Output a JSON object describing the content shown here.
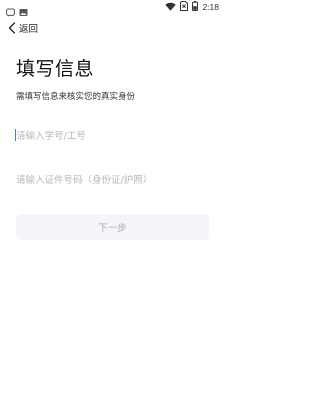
{
  "status_bar": {
    "time": "2:18",
    "icons": [
      "notification-icon",
      "image-icon",
      "wifi-icon",
      "no-sim-icon",
      "battery-icon"
    ]
  },
  "nav": {
    "back_label": "返回",
    "back_icon": "chevron-left-icon"
  },
  "page": {
    "title": "填写信息",
    "subtitle": "需填写信息来核实您的真实身份"
  },
  "form": {
    "student_id": {
      "value": "",
      "placeholder": "请输入学号/工号"
    },
    "id_number": {
      "value": "",
      "placeholder": "请输入证件号码（身份证/护照）"
    },
    "next_label": "下一步"
  },
  "colors": {
    "caret": "#3b7cf0",
    "placeholder": "#b7b7b7",
    "button_bg": "#f4f5f8",
    "button_text": "#a7aab3"
  }
}
